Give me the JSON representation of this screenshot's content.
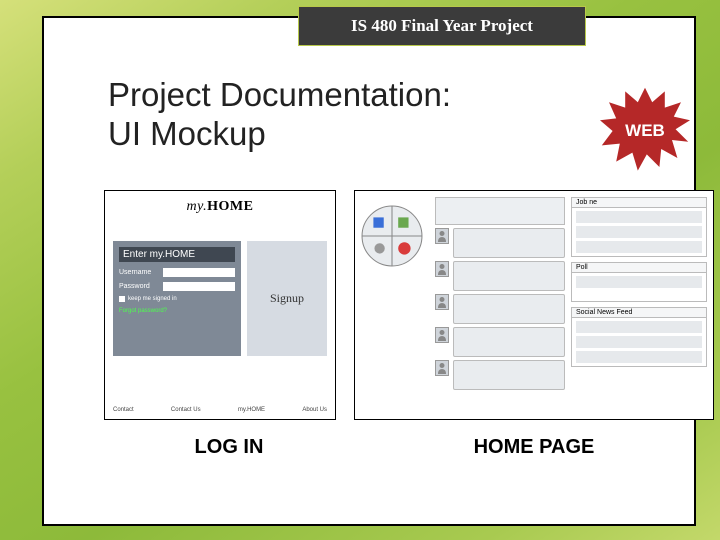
{
  "banner": "IS 480 Final Year Project",
  "heading_line1": "Project Documentation:",
  "heading_line2": "UI Mockup",
  "badge": "WEB",
  "login": {
    "logo_prefix": "my.",
    "logo_main": "HOME",
    "form_title": "Enter my.HOME",
    "username_label": "Username",
    "password_label": "Password",
    "remember_label": "keep me signed in",
    "forgot": "Forgot password?",
    "signup": "Signup",
    "footer": [
      "Contact",
      "Contact Us",
      "my.HOME",
      "About Us"
    ]
  },
  "home": {
    "col3_top_tab": "Job ne",
    "col3_box2_label": "Poll",
    "col3_box3_label": "Social News Feed"
  },
  "captions": {
    "left": "LOG IN",
    "right": "HOME PAGE"
  }
}
